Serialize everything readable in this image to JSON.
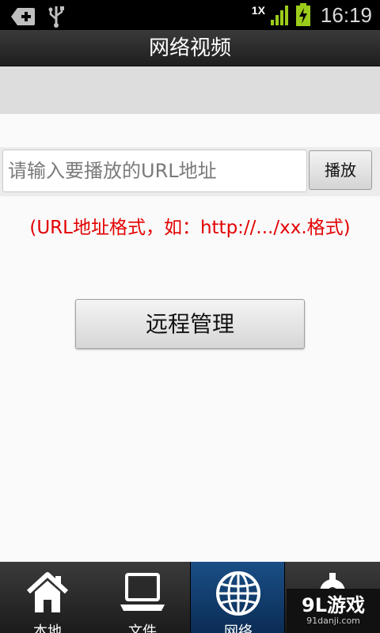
{
  "statusbar": {
    "network_label": "1X",
    "time": "16:19"
  },
  "header": {
    "title": "网络视频"
  },
  "url_input": {
    "placeholder": "请输入要播放的URL地址",
    "value": ""
  },
  "play_button": {
    "label": "播放"
  },
  "hint_text": "(URL地址格式，如：http://.../xx.格式)",
  "remote_button": {
    "label": "远程管理"
  },
  "tabs": [
    {
      "label": "本地",
      "icon": "home-icon"
    },
    {
      "label": "文件",
      "icon": "laptop-icon"
    },
    {
      "label": "网络",
      "icon": "globe-icon",
      "active": true
    },
    {
      "label": "",
      "icon": "gear-icon"
    }
  ],
  "watermark": {
    "title": "9L游戏",
    "subtitle": "91danji.com"
  },
  "colors": {
    "hint_red": "#e30000",
    "active_tab": "#1a4f86"
  }
}
